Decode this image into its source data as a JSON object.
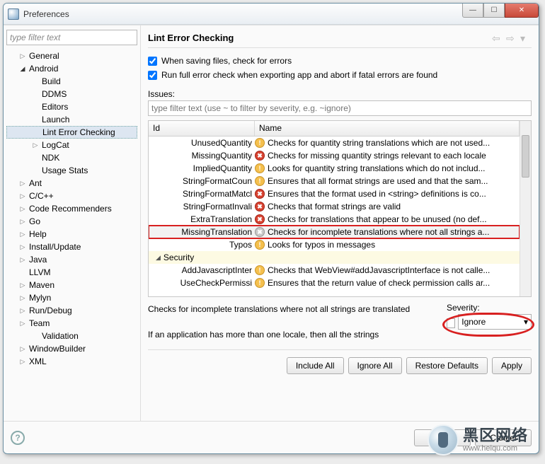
{
  "window": {
    "title": "Preferences"
  },
  "sidebar": {
    "filter_placeholder": "type filter text",
    "items": [
      {
        "label": "General",
        "level": 1,
        "toggle": "▷"
      },
      {
        "label": "Android",
        "level": 1,
        "toggle": "◢",
        "open": true
      },
      {
        "label": "Build",
        "level": 2
      },
      {
        "label": "DDMS",
        "level": 2
      },
      {
        "label": "Editors",
        "level": 2
      },
      {
        "label": "Launch",
        "level": 2
      },
      {
        "label": "Lint Error Checking",
        "level": 2,
        "selected": true
      },
      {
        "label": "LogCat",
        "level": 2,
        "toggle": "▷"
      },
      {
        "label": "NDK",
        "level": 2
      },
      {
        "label": "Usage Stats",
        "level": 2
      },
      {
        "label": "Ant",
        "level": 1,
        "toggle": "▷"
      },
      {
        "label": "C/C++",
        "level": 1,
        "toggle": "▷"
      },
      {
        "label": "Code Recommenders",
        "level": 1,
        "toggle": "▷"
      },
      {
        "label": "Go",
        "level": 1,
        "toggle": "▷"
      },
      {
        "label": "Help",
        "level": 1,
        "toggle": "▷"
      },
      {
        "label": "Install/Update",
        "level": 1,
        "toggle": "▷"
      },
      {
        "label": "Java",
        "level": 1,
        "toggle": "▷"
      },
      {
        "label": "LLVM",
        "level": 1
      },
      {
        "label": "Maven",
        "level": 1,
        "toggle": "▷"
      },
      {
        "label": "Mylyn",
        "level": 1,
        "toggle": "▷"
      },
      {
        "label": "Run/Debug",
        "level": 1,
        "toggle": "▷"
      },
      {
        "label": "Team",
        "level": 1,
        "toggle": "▷"
      },
      {
        "label": "Validation",
        "level": 2
      },
      {
        "label": "WindowBuilder",
        "level": 1,
        "toggle": "▷"
      },
      {
        "label": "XML",
        "level": 1,
        "toggle": "▷"
      }
    ]
  },
  "page": {
    "title": "Lint Error Checking",
    "chk1": "When saving files, check for errors",
    "chk2": "Run full error check when exporting app and abort if fatal errors are found",
    "issues_label": "Issues:",
    "issues_filter_placeholder": "type filter text (use ~ to filter by severity, e.g. ~ignore)",
    "columns": {
      "id": "Id",
      "name": "Name"
    },
    "rows": [
      {
        "id": "UnusedQuantity",
        "sev": "warn",
        "desc": "Checks for quantity string translations which are not used..."
      },
      {
        "id": "MissingQuantity",
        "sev": "err",
        "desc": "Checks for missing quantity strings relevant to each locale"
      },
      {
        "id": "ImpliedQuantity",
        "sev": "warn",
        "desc": "Looks for quantity string translations which do not includ..."
      },
      {
        "id": "StringFormatCoun",
        "sev": "warn",
        "desc": "Ensures that all format strings are used and that the sam..."
      },
      {
        "id": "StringFormatMatcl",
        "sev": "err",
        "desc": "Ensures that the format used in <string> definitions is co..."
      },
      {
        "id": "StringFormatInvali",
        "sev": "err",
        "desc": "Checks that format strings are valid"
      },
      {
        "id": "ExtraTranslation",
        "sev": "err",
        "desc": "Checks for translations that appear to be unused (no def..."
      },
      {
        "id": "MissingTranslation",
        "sev": "ign",
        "desc": "Checks for incomplete translations where not all strings a...",
        "selected": true
      },
      {
        "id": "Typos",
        "sev": "warn",
        "desc": "Looks for typos in messages"
      },
      {
        "cat": true,
        "id": "Security"
      },
      {
        "id": "AddJavascriptInter",
        "sev": "warn",
        "desc": "Checks that WebView#addJavascriptInterface is not calle..."
      },
      {
        "id": "UseCheckPermissi",
        "sev": "warn",
        "desc": "Ensures that the return value of check permission calls ar..."
      }
    ],
    "detail": "Checks for incomplete translations where not all strings are translated\n\nIf an application has more than one locale, then all the strings",
    "severity_label": "Severity:",
    "severity_value": "Ignore",
    "buttons": {
      "include_all": "Include All",
      "ignore_all": "Ignore All",
      "restore": "Restore Defaults",
      "apply": "Apply",
      "ok": "OK",
      "cancel": "Cancel"
    }
  },
  "watermark": {
    "big": "黑区网络",
    "small": "www.heiqu.com"
  }
}
